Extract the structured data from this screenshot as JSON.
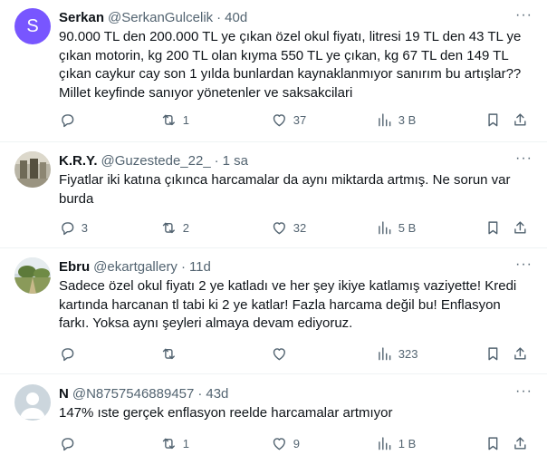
{
  "tweets": [
    {
      "avatar_letter": "S",
      "avatar_color": "#7856ff",
      "name": "Serkan",
      "handle": "@SerkanGulcelik",
      "time": "40d",
      "text": "90.000 TL den 200.000 TL ye çıkan özel okul fiyatı, litresi 19 TL den 43 TL ye çıkan motorin, kg 200 TL olan kıyma 550 TL ye çıkan, kg 67 TL den 149 TL çıkan caykur cay son 1 yılda bunlardan kaynaklanmıyor sanırım bu artışlar?? Millet keyfinde sanıyor yönetenler ve saksakcilari",
      "replies": "",
      "retweets": "1",
      "likes": "37",
      "views": "3 B"
    },
    {
      "name": "K.R.Y.",
      "handle": "@Guzestede_22_",
      "time": "1 sa",
      "text": "Fiyatlar iki katına çıkınca harcamalar da aynı miktarda artmış. Ne sorun var burda",
      "replies": "3",
      "retweets": "2",
      "likes": "32",
      "views": "5 B"
    },
    {
      "name": "Ebru",
      "handle": "@ekartgallery",
      "time": "11d",
      "text": "Sadece özel okul fiyatı 2 ye katladı ve her şey ikiye katlamış vaziyette! Kredi kartında harcanan tl tabi ki 2 ye katlar! Fazla harcama değil bu! Enflasyon farkı. Yoksa aynı şeyleri almaya devam ediyoruz.",
      "replies": "",
      "retweets": "",
      "likes": "",
      "views": "323"
    },
    {
      "name": "N",
      "handle": "@N8757546889457",
      "time": "43d",
      "text": "147% ıste gerçek enflasyon reelde harcamalar artmıyor",
      "replies": "",
      "retweets": "1",
      "likes": "9",
      "views": "1 B"
    }
  ],
  "colors": {
    "text": "#0f1419",
    "muted": "#536471",
    "divider": "#eff3f4",
    "avatar_s": "#7856ff"
  }
}
